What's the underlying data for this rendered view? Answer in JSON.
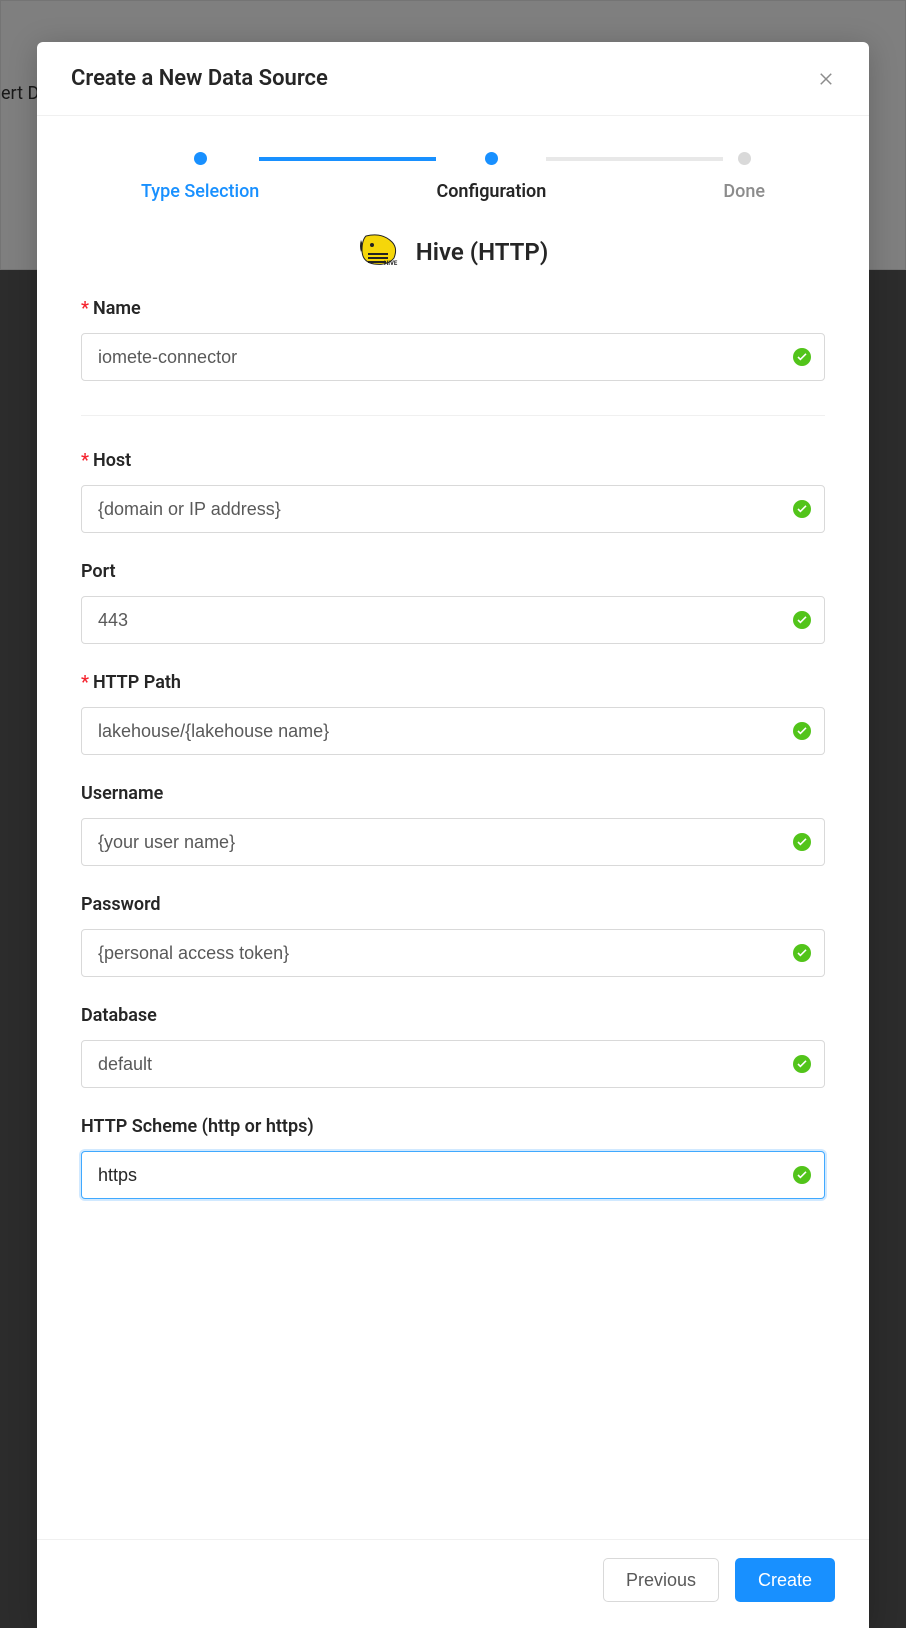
{
  "bgPanelText": "ert D",
  "modalTitle": "Create a New Data Source",
  "steps": {
    "typeSelection": "Type Selection",
    "configuration": "Configuration",
    "done": "Done"
  },
  "sourceTitle": "Hive (HTTP)",
  "fields": {
    "name": {
      "label": "Name",
      "value": "iomete-connector",
      "required": true
    },
    "host": {
      "label": "Host",
      "value": "{domain or IP address}",
      "required": true
    },
    "port": {
      "label": "Port",
      "value": "443",
      "required": false
    },
    "httpPath": {
      "label": "HTTP Path",
      "value": "lakehouse/{lakehouse name}",
      "required": true
    },
    "username": {
      "label": "Username",
      "value": "{your user name}",
      "required": false
    },
    "password": {
      "label": "Password",
      "value": "{personal access token}",
      "required": false
    },
    "database": {
      "label": "Database",
      "value": "default",
      "required": false
    },
    "httpScheme": {
      "label": "HTTP Scheme (http or https)",
      "value": "https",
      "required": false
    }
  },
  "buttons": {
    "previous": "Previous",
    "create": "Create"
  }
}
